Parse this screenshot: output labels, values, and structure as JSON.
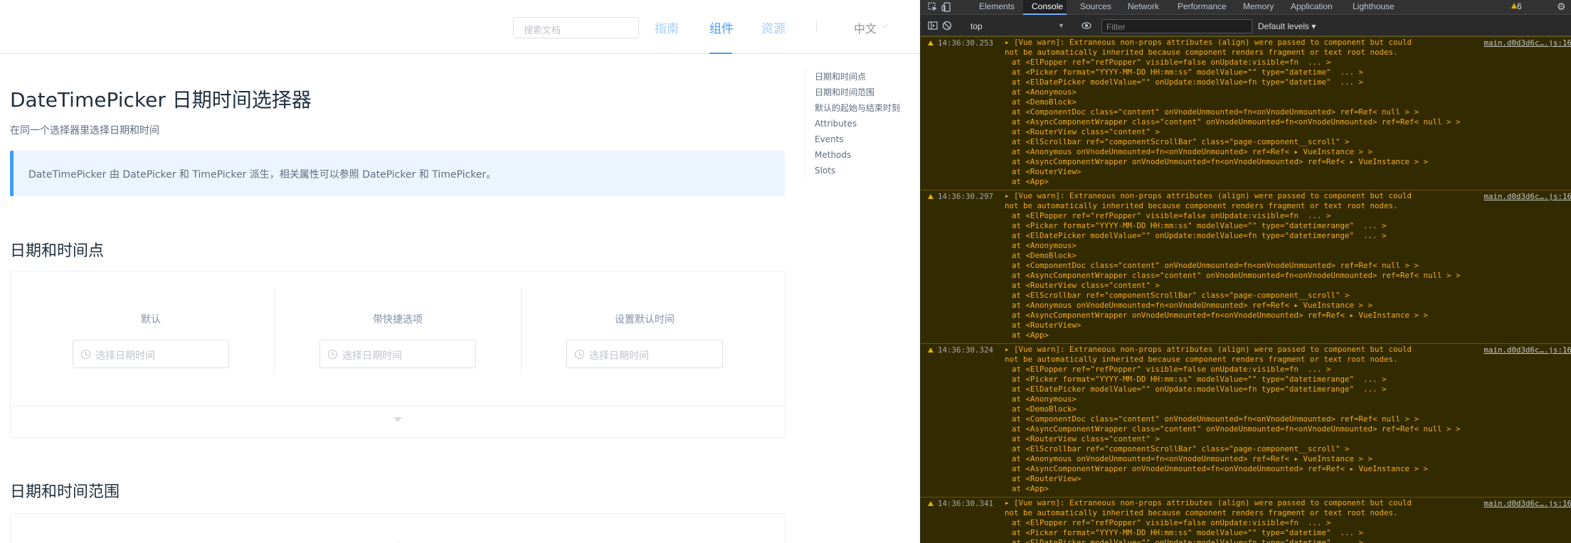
{
  "docs": {
    "search_placeholder": "搜索文档",
    "nav": [
      "指南",
      "组件",
      "资源"
    ],
    "active_nav": "组件",
    "lang": "中文",
    "title": "DateTimePicker 日期时间选择器",
    "description": "在同一个选择器里选择日期和时间",
    "tip": "DateTimePicker 由 DatePicker 和 TimePicker 派生，相关属性可以参照 DatePicker 和 TimePicker。",
    "section1": "日期和时间点",
    "section2": "日期和时间范围",
    "demo_columns": [
      {
        "label": "默认",
        "placeholder": "选择日期时间"
      },
      {
        "label": "带快捷选项",
        "placeholder": "选择日期时间"
      },
      {
        "label": "设置默认时间",
        "placeholder": "选择日期时间"
      }
    ],
    "toc": [
      "日期和时间点",
      "日期和时间范围",
      "默认的起始与结束时刻",
      "Attributes",
      "Events",
      "Methods",
      "Slots"
    ]
  },
  "devtools": {
    "tabs": [
      "Elements",
      "Console",
      "Sources",
      "Network",
      "Performance",
      "Memory",
      "Application",
      "Lighthouse"
    ],
    "active_tab": "Console",
    "warning_count": "6",
    "context": "top",
    "filter_placeholder": "Filter",
    "levels": "Default levels",
    "entries": [
      {
        "time": "14:36:30.253",
        "source": "main.d0d3d6c….js:16",
        "head": "[Vue warn]: Extraneous non-props attributes (align) were passed to component but could",
        "head2": "not be automatically inherited because component renders fragment or text root nodes.",
        "lines": [
          "at <ElPopper ref=\"refPopper\" visible=false onUpdate:visible=fn  ... >",
          "at <Picker format=\"YYYY-MM-DD HH:mm:ss\" modelValue=\"\" type=\"datetime\"  ... >",
          "at <ElDatePicker modelValue=\"\" onUpdate:modelValue=fn type=\"datetime\"  ... >",
          "at <Anonymous>",
          "at <DemoBlock>",
          "at <ComponentDoc class=\"content\" onVnodeUnmounted=fn<onVnodeUnmounted> ref=Ref< null > >",
          "at <AsyncComponentWrapper class=\"content\" onVnodeUnmounted=fn<onVnodeUnmounted> ref=Ref< null > >",
          "at <RouterView class=\"content\" >",
          "at <ElScrollbar ref=\"componentScrollBar\" class=\"page-component__scroll\" >",
          "at <Anonymous onVnodeUnmounted=fn<onVnodeUnmounted> ref=Ref< ▸ VueInstance > >",
          "at <AsyncComponentWrapper onVnodeUnmounted=fn<onVnodeUnmounted> ref=Ref< ▸ VueInstance > >",
          "at <RouterView>",
          "at <App>"
        ]
      },
      {
        "time": "14:36:30.297",
        "source": "main.d0d3d6c….js:16",
        "head": "[Vue warn]: Extraneous non-props attributes (align) were passed to component but could",
        "head2": "not be automatically inherited because component renders fragment or text root nodes.",
        "lines": [
          "at <ElPopper ref=\"refPopper\" visible=false onUpdate:visible=fn  ... >",
          "at <Picker format=\"YYYY-MM-DD HH:mm:ss\" modelValue=\"\" type=\"datetimerange\"  ... >",
          "at <ElDatePicker modelValue=\"\" onUpdate:modelValue=fn type=\"datetimerange\"  ... >",
          "at <Anonymous>",
          "at <DemoBlock>",
          "at <ComponentDoc class=\"content\" onVnodeUnmounted=fn<onVnodeUnmounted> ref=Ref< null > >",
          "at <AsyncComponentWrapper class=\"content\" onVnodeUnmounted=fn<onVnodeUnmounted> ref=Ref< null > >",
          "at <RouterView class=\"content\" >",
          "at <ElScrollbar ref=\"componentScrollBar\" class=\"page-component__scroll\" >",
          "at <Anonymous onVnodeUnmounted=fn<onVnodeUnmounted> ref=Ref< ▸ VueInstance > >",
          "at <AsyncComponentWrapper onVnodeUnmounted=fn<onVnodeUnmounted> ref=Ref< ▸ VueInstance > >",
          "at <RouterView>",
          "at <App>"
        ]
      },
      {
        "time": "14:36:30.324",
        "source": "main.d0d3d6c….js:16",
        "head": "[Vue warn]: Extraneous non-props attributes (align) were passed to component but could",
        "head2": "not be automatically inherited because component renders fragment or text root nodes.",
        "lines": [
          "at <ElPopper ref=\"refPopper\" visible=false onUpdate:visible=fn  ... >",
          "at <Picker format=\"YYYY-MM-DD HH:mm:ss\" modelValue=\"\" type=\"datetimerange\"  ... >",
          "at <ElDatePicker modelValue=\"\" onUpdate:modelValue=fn type=\"datetimerange\"  ... >",
          "at <Anonymous>",
          "at <DemoBlock>",
          "at <ComponentDoc class=\"content\" onVnodeUnmounted=fn<onVnodeUnmounted> ref=Ref< null > >",
          "at <AsyncComponentWrapper class=\"content\" onVnodeUnmounted=fn<onVnodeUnmounted> ref=Ref< null > >",
          "at <RouterView class=\"content\" >",
          "at <ElScrollbar ref=\"componentScrollBar\" class=\"page-component__scroll\" >",
          "at <Anonymous onVnodeUnmounted=fn<onVnodeUnmounted> ref=Ref< ▸ VueInstance > >",
          "at <AsyncComponentWrapper onVnodeUnmounted=fn<onVnodeUnmounted> ref=Ref< ▸ VueInstance > >",
          "at <RouterView>",
          "at <App>"
        ]
      },
      {
        "time": "14:36:30.341",
        "source": "main.d0d3d6c….js:16",
        "head": "[Vue warn]: Extraneous non-props attributes (align) were passed to component but could",
        "head2": "not be automatically inherited because component renders fragment or text root nodes.",
        "lines": [
          "at <ElPopper ref=\"refPopper\" visible=false onUpdate:visible=fn  ... >",
          "at <Picker format=\"YYYY-MM-DD HH:mm:ss\" modelValue=\"\" type=\"datetime\"  ... >",
          "at <ElDatePicker modelValue=\"\" onUpdate:modelValue=fn type=\"datetime\"  ... >"
        ]
      }
    ]
  },
  "colors": {
    "accent": "#409eff",
    "warning_bg": "#332b00",
    "warning_text": "#f2ab26"
  }
}
